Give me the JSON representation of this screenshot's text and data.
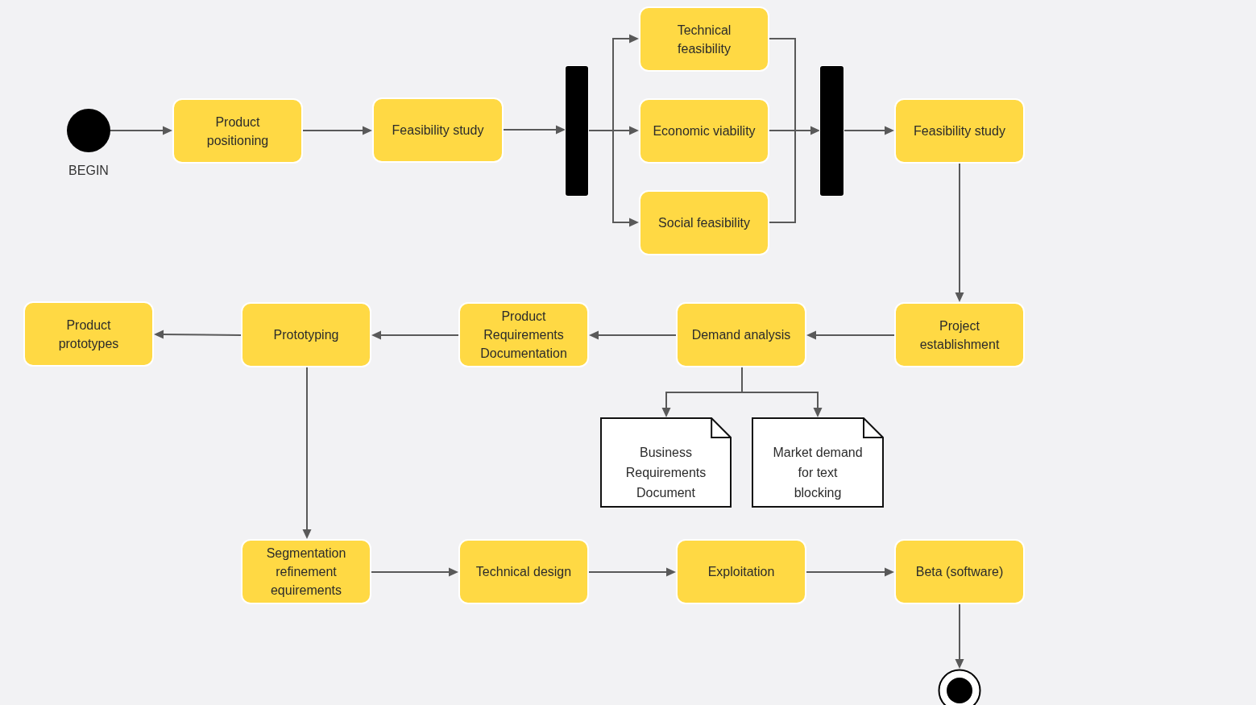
{
  "diagram": {
    "nodes": [
      {
        "kind": "start",
        "label": "BEGIN"
      },
      {
        "kind": "action",
        "label": "Product\npositioning"
      },
      {
        "kind": "action",
        "label": "Feasibility study"
      },
      {
        "kind": "bar"
      },
      {
        "kind": "action",
        "label": "Technical\nfeasibility"
      },
      {
        "kind": "action",
        "label": "Economic viability"
      },
      {
        "kind": "action",
        "label": "Social feasibility"
      },
      {
        "kind": "bar"
      },
      {
        "kind": "action",
        "label": "Feasibility study"
      },
      {
        "kind": "action",
        "label": "Product\nprototypes"
      },
      {
        "kind": "action",
        "label": "Prototyping"
      },
      {
        "kind": "action",
        "label": "Product\nRequirements\nDocumentation"
      },
      {
        "kind": "action",
        "label": "Demand analysis"
      },
      {
        "kind": "action",
        "label": "Project\nestablishment"
      },
      {
        "kind": "document",
        "label": "Business\nRequirements\nDocument"
      },
      {
        "kind": "document",
        "label": "Market demand\nfor text\nblocking"
      },
      {
        "kind": "action",
        "label": "Segmentation\nrefinement\nequirements"
      },
      {
        "kind": "action",
        "label": "Technical design"
      },
      {
        "kind": "action",
        "label": "Exploitation"
      },
      {
        "kind": "action",
        "label": "Beta (software)"
      },
      {
        "kind": "end"
      }
    ]
  }
}
